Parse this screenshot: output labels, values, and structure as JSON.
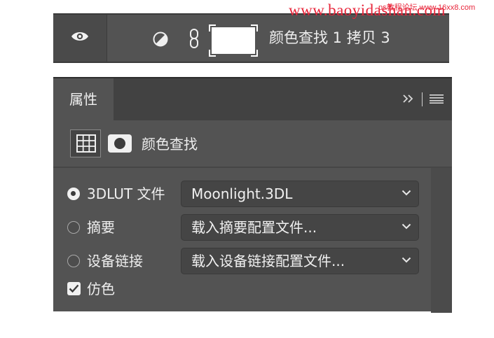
{
  "watermark": {
    "text": "www.baoyidashan.com",
    "sub": "ps教程论坛 www.16xx8.com"
  },
  "layer": {
    "name": "颜色查找 1 拷贝 3",
    "visibility_icon": "eye-icon",
    "adjustment_icon": "adjustment-circle-icon",
    "link_icon": "chain-link-icon",
    "mask_color": "#ffffff"
  },
  "properties_panel": {
    "tab_label": "属性",
    "collapse_icon": "double-chevron-right-icon",
    "menu_icon": "hamburger-menu-icon",
    "mode_title": "颜色查找",
    "options": [
      {
        "label": "3DLUT 文件",
        "value": "Moonlight.3DL",
        "selected": true
      },
      {
        "label": "摘要",
        "value": "载入摘要配置文件...",
        "selected": false
      },
      {
        "label": "设备链接",
        "value": "载入设备链接配置文件...",
        "selected": false
      }
    ],
    "dither": {
      "label": "仿色",
      "checked": true
    }
  },
  "colors": {
    "panel_bg": "#535353",
    "tab_bar_bg": "#424242",
    "select_bg": "#454545",
    "text": "#eeeeee"
  }
}
